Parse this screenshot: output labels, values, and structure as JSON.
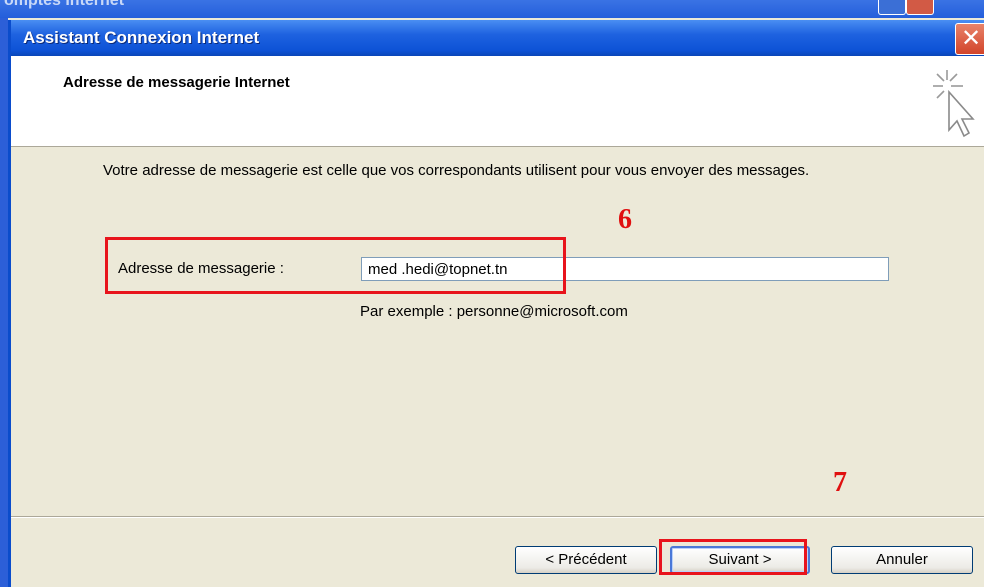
{
  "background_window": {
    "title_fragment": "omptes Internet"
  },
  "dialog": {
    "title": "Assistant Connexion Internet",
    "close_glyph": "✕",
    "header_title": "Adresse de messagerie Internet",
    "description": "Votre adresse de messagerie est celle que vos correspondants utilisent pour vous envoyer des messages.",
    "field_label": "Adresse de messagerie :",
    "email_value": "med .hedi@topnet.tn",
    "example_text": "Par exemple : personne@microsoft.com",
    "buttons": {
      "back": "< Précédent",
      "next": "Suivant >",
      "cancel": "Annuler"
    }
  },
  "annotations": {
    "step_field": "6",
    "step_next": "7",
    "color": "#e8141c"
  },
  "icons": {
    "wizard": "wizard-sparkle-cursor-icon",
    "close": "close-icon"
  }
}
